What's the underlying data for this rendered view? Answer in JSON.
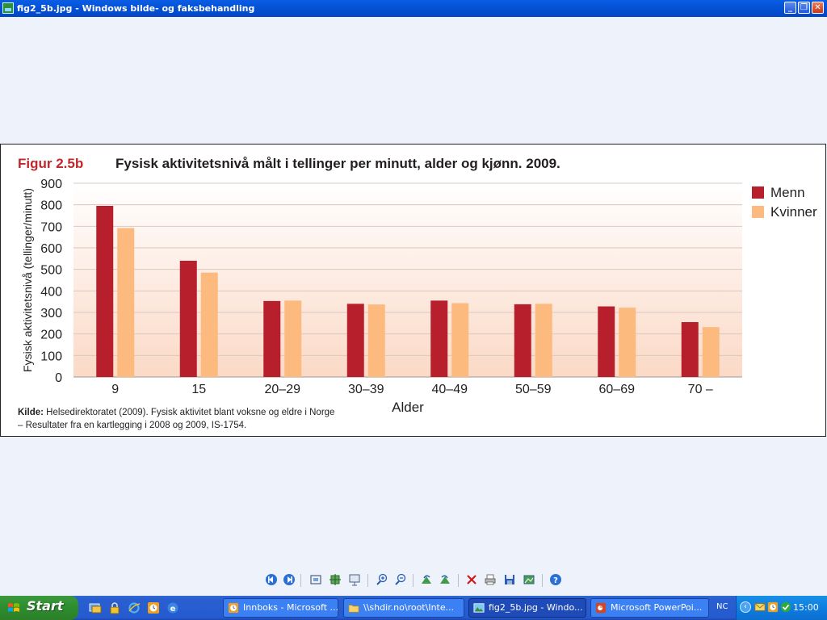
{
  "window": {
    "title": "fig2_5b.jpg - Windows bilde- og faksbehandling",
    "minimize_label": "_",
    "restore_label": "❐",
    "close_label": "✕"
  },
  "figure": {
    "label": "Figur 2.5b",
    "title": "Fysisk aktivitetsnivå målt i tellinger per minutt, alder og kjønn. 2009.",
    "source_bold": "Kilde:",
    "source_line1": " Helsedirektoratet (2009). Fysisk aktivitet blant voksne og eldre i Norge",
    "source_line2": "– Resultater fra en kartlegging i 2008 og 2009, IS-1754."
  },
  "chart_data": {
    "type": "bar",
    "title": "Fysisk aktivitetsnivå målt i tellinger per minutt, alder og kjønn. 2009.",
    "xlabel": "Alder",
    "ylabel": "Fysisk aktivitetsnivå (tellinger/minutt)",
    "categories": [
      "9",
      "15",
      "20–29",
      "30–39",
      "40–49",
      "50–59",
      "60–69",
      "70 –"
    ],
    "series": [
      {
        "name": "Menn",
        "color": "#b81f2d",
        "values": [
          795,
          540,
          353,
          340,
          355,
          338,
          328,
          255
        ]
      },
      {
        "name": "Kvinner",
        "color": "#fdba7e",
        "values": [
          692,
          485,
          355,
          337,
          343,
          340,
          322,
          232
        ]
      }
    ],
    "ylim": [
      0,
      900
    ],
    "yticks": [
      0,
      100,
      200,
      300,
      400,
      500,
      600,
      700,
      800,
      900
    ],
    "grid": true,
    "legend": "right"
  },
  "toolbar": {
    "buttons": [
      "previous-image-icon",
      "next-image-icon",
      "best-fit-icon",
      "actual-size-icon",
      "slideshow-icon",
      "zoom-in-icon",
      "zoom-out-icon",
      "rotate-clockwise-icon",
      "rotate-counterclockwise-icon",
      "delete-icon",
      "print-icon",
      "save-icon",
      "edit-icon",
      "help-icon"
    ]
  },
  "taskbar": {
    "start_label": "Start",
    "tasks": [
      {
        "label": "Innboks - Microsoft ...",
        "icon": "outlook-icon"
      },
      {
        "label": "\\\\shdir.no\\root\\Inte...",
        "icon": "folder-icon"
      },
      {
        "label": "fig2_5b.jpg - Windo...",
        "icon": "image-viewer-icon",
        "active": true
      },
      {
        "label": "Microsoft PowerPoi...",
        "icon": "powerpoint-icon"
      }
    ],
    "language": "NC",
    "clock": "15:00"
  }
}
